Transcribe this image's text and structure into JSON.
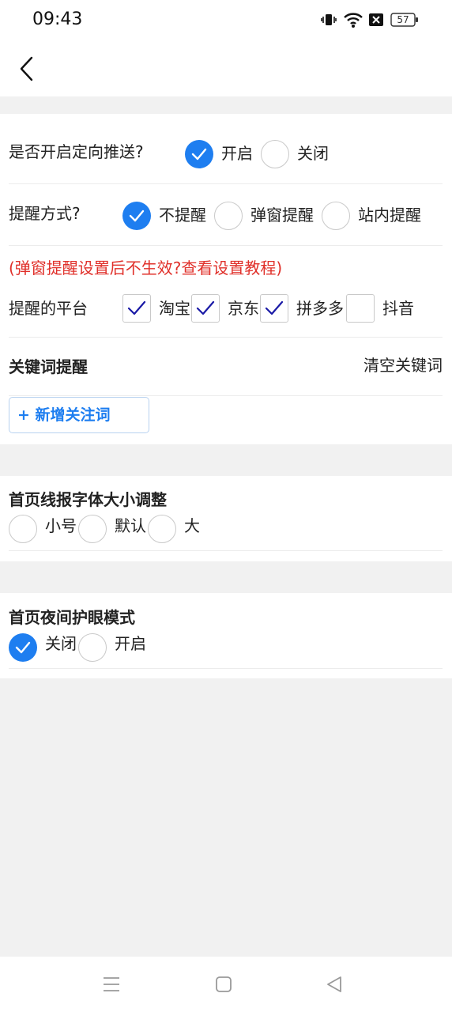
{
  "status_bar": {
    "time": "09:43",
    "battery": "57"
  },
  "push": {
    "label": "是否开启定向推送?",
    "options": [
      {
        "label": "开启",
        "selected": true
      },
      {
        "label": "关闭",
        "selected": false
      }
    ]
  },
  "remind_mode": {
    "label": "提醒方式?",
    "options": [
      {
        "label": "不提醒",
        "selected": true
      },
      {
        "label": "弹窗提醒",
        "selected": false
      },
      {
        "label": "站内提醒",
        "selected": false
      }
    ]
  },
  "tutorial_link": "(弹窗提醒设置后不生效?查看设置教程)",
  "platforms": {
    "label": "提醒的平台",
    "options": [
      {
        "label": "淘宝",
        "checked": true
      },
      {
        "label": "京东",
        "checked": true
      },
      {
        "label": "拼多多",
        "checked": true
      },
      {
        "label": "抖音",
        "checked": false
      }
    ]
  },
  "keywords": {
    "title": "关键词提醒",
    "clear_label": "清空关键词",
    "add_label": "+ 新增关注词"
  },
  "font_size": {
    "title": "首页线报字体大小调整",
    "options": [
      {
        "label": "小号",
        "selected": false
      },
      {
        "label": "默认",
        "selected": false
      },
      {
        "label": "大",
        "selected": false
      }
    ]
  },
  "night_mode": {
    "title": "首页夜间护眼模式",
    "options": [
      {
        "label": "关闭",
        "selected": true
      },
      {
        "label": "开启",
        "selected": false
      }
    ]
  },
  "colors": {
    "accent": "#1e7ef0",
    "link_red": "#e0302a",
    "check_navy": "#1a1aa6",
    "gap_gray": "#f1f1f1"
  }
}
